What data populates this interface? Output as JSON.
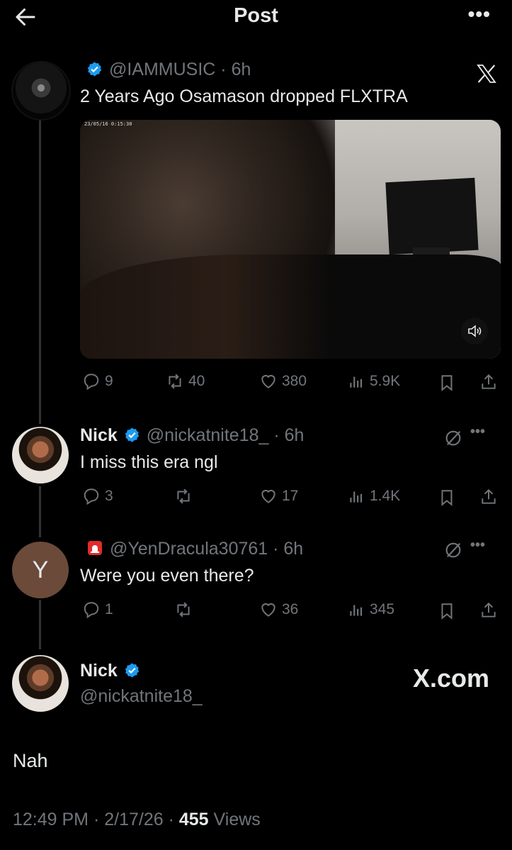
{
  "header": {
    "title": "Post"
  },
  "original_post": {
    "handle": "@IAMMUSIC",
    "time": "6h",
    "text": "2 Years Ago Osamason dropped FLXTRA",
    "video_timestamp": "23/05/16 0:15:30",
    "replies": "9",
    "reposts": "40",
    "likes": "380",
    "views": "5.9K"
  },
  "reply_1": {
    "name": "Nick",
    "handle": "@nickatnite18_",
    "time": "6h",
    "text": "I miss this era ngl",
    "replies": "3",
    "reposts": "",
    "likes": "17",
    "views": "1.4K"
  },
  "reply_2": {
    "avatar_letter": "Y",
    "handle": "@YenDracula30761",
    "time": "6h",
    "text": "Were you even there?",
    "replies": "1",
    "reposts": "",
    "likes": "36",
    "views": "345"
  },
  "main_post": {
    "name": "Nick",
    "handle": "@nickatnite18_",
    "text": "Nah",
    "time": "12:49 PM",
    "date": "2/17/26",
    "views_count": "455",
    "views_label": "Views",
    "watermark": "X.com"
  },
  "colors": {
    "background": "#000000",
    "text": "#e7e9ea",
    "muted": "#71767b",
    "verified": "#1d9bf0"
  }
}
